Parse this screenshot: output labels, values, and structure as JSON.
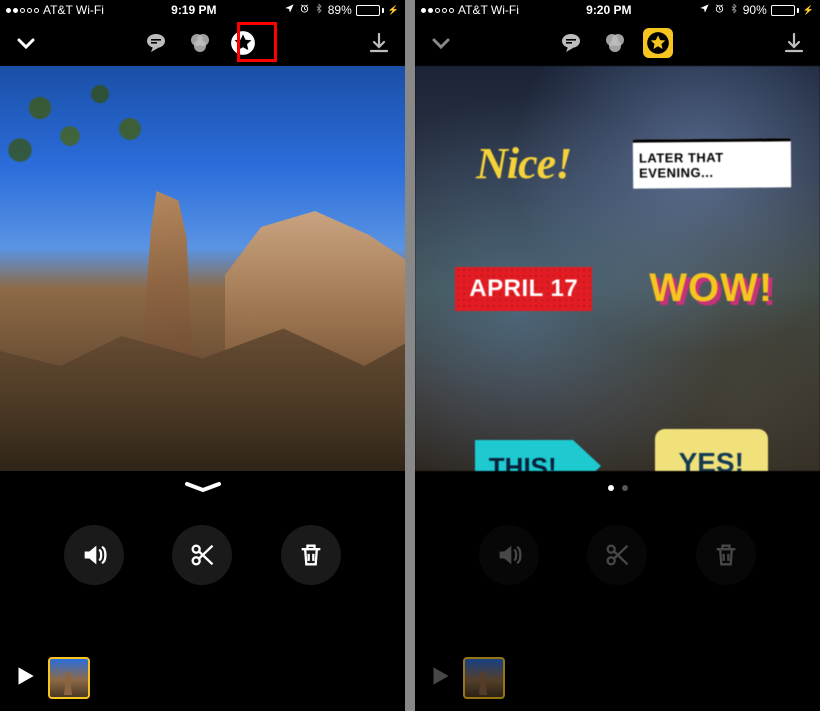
{
  "left": {
    "status": {
      "carrier": "AT&T Wi-Fi",
      "time": "9:19 PM",
      "battery_pct": "89%",
      "battery_fill_pct": 89
    },
    "toolbar": {
      "collapse_name": "chevron-down-icon",
      "speech_name": "speech-bubble-icon",
      "filters_name": "filters-icon",
      "stickers_name": "stickers-icon",
      "stickers_active": false,
      "download_name": "download-icon"
    },
    "grabber_name": "grabber-handle",
    "actions": {
      "mute_name": "sound-button",
      "trim_name": "scissors-button",
      "delete_name": "trash-button"
    },
    "timeline": {
      "play_name": "play-button",
      "thumb_name": "clip-thumbnail"
    },
    "highlight_visible": true
  },
  "right": {
    "status": {
      "carrier": "AT&T Wi-Fi",
      "time": "9:20 PM",
      "battery_pct": "90%",
      "battery_fill_pct": 90
    },
    "toolbar": {
      "stickers_active": true
    },
    "stickers": {
      "nice": "Nice!",
      "later": "LATER THAT EVENING...",
      "april": "APRIL 17",
      "wow": "WOW!",
      "this": "THIS!",
      "yes": "YES!"
    },
    "page_indicator": {
      "count": 2,
      "active": 0
    }
  }
}
